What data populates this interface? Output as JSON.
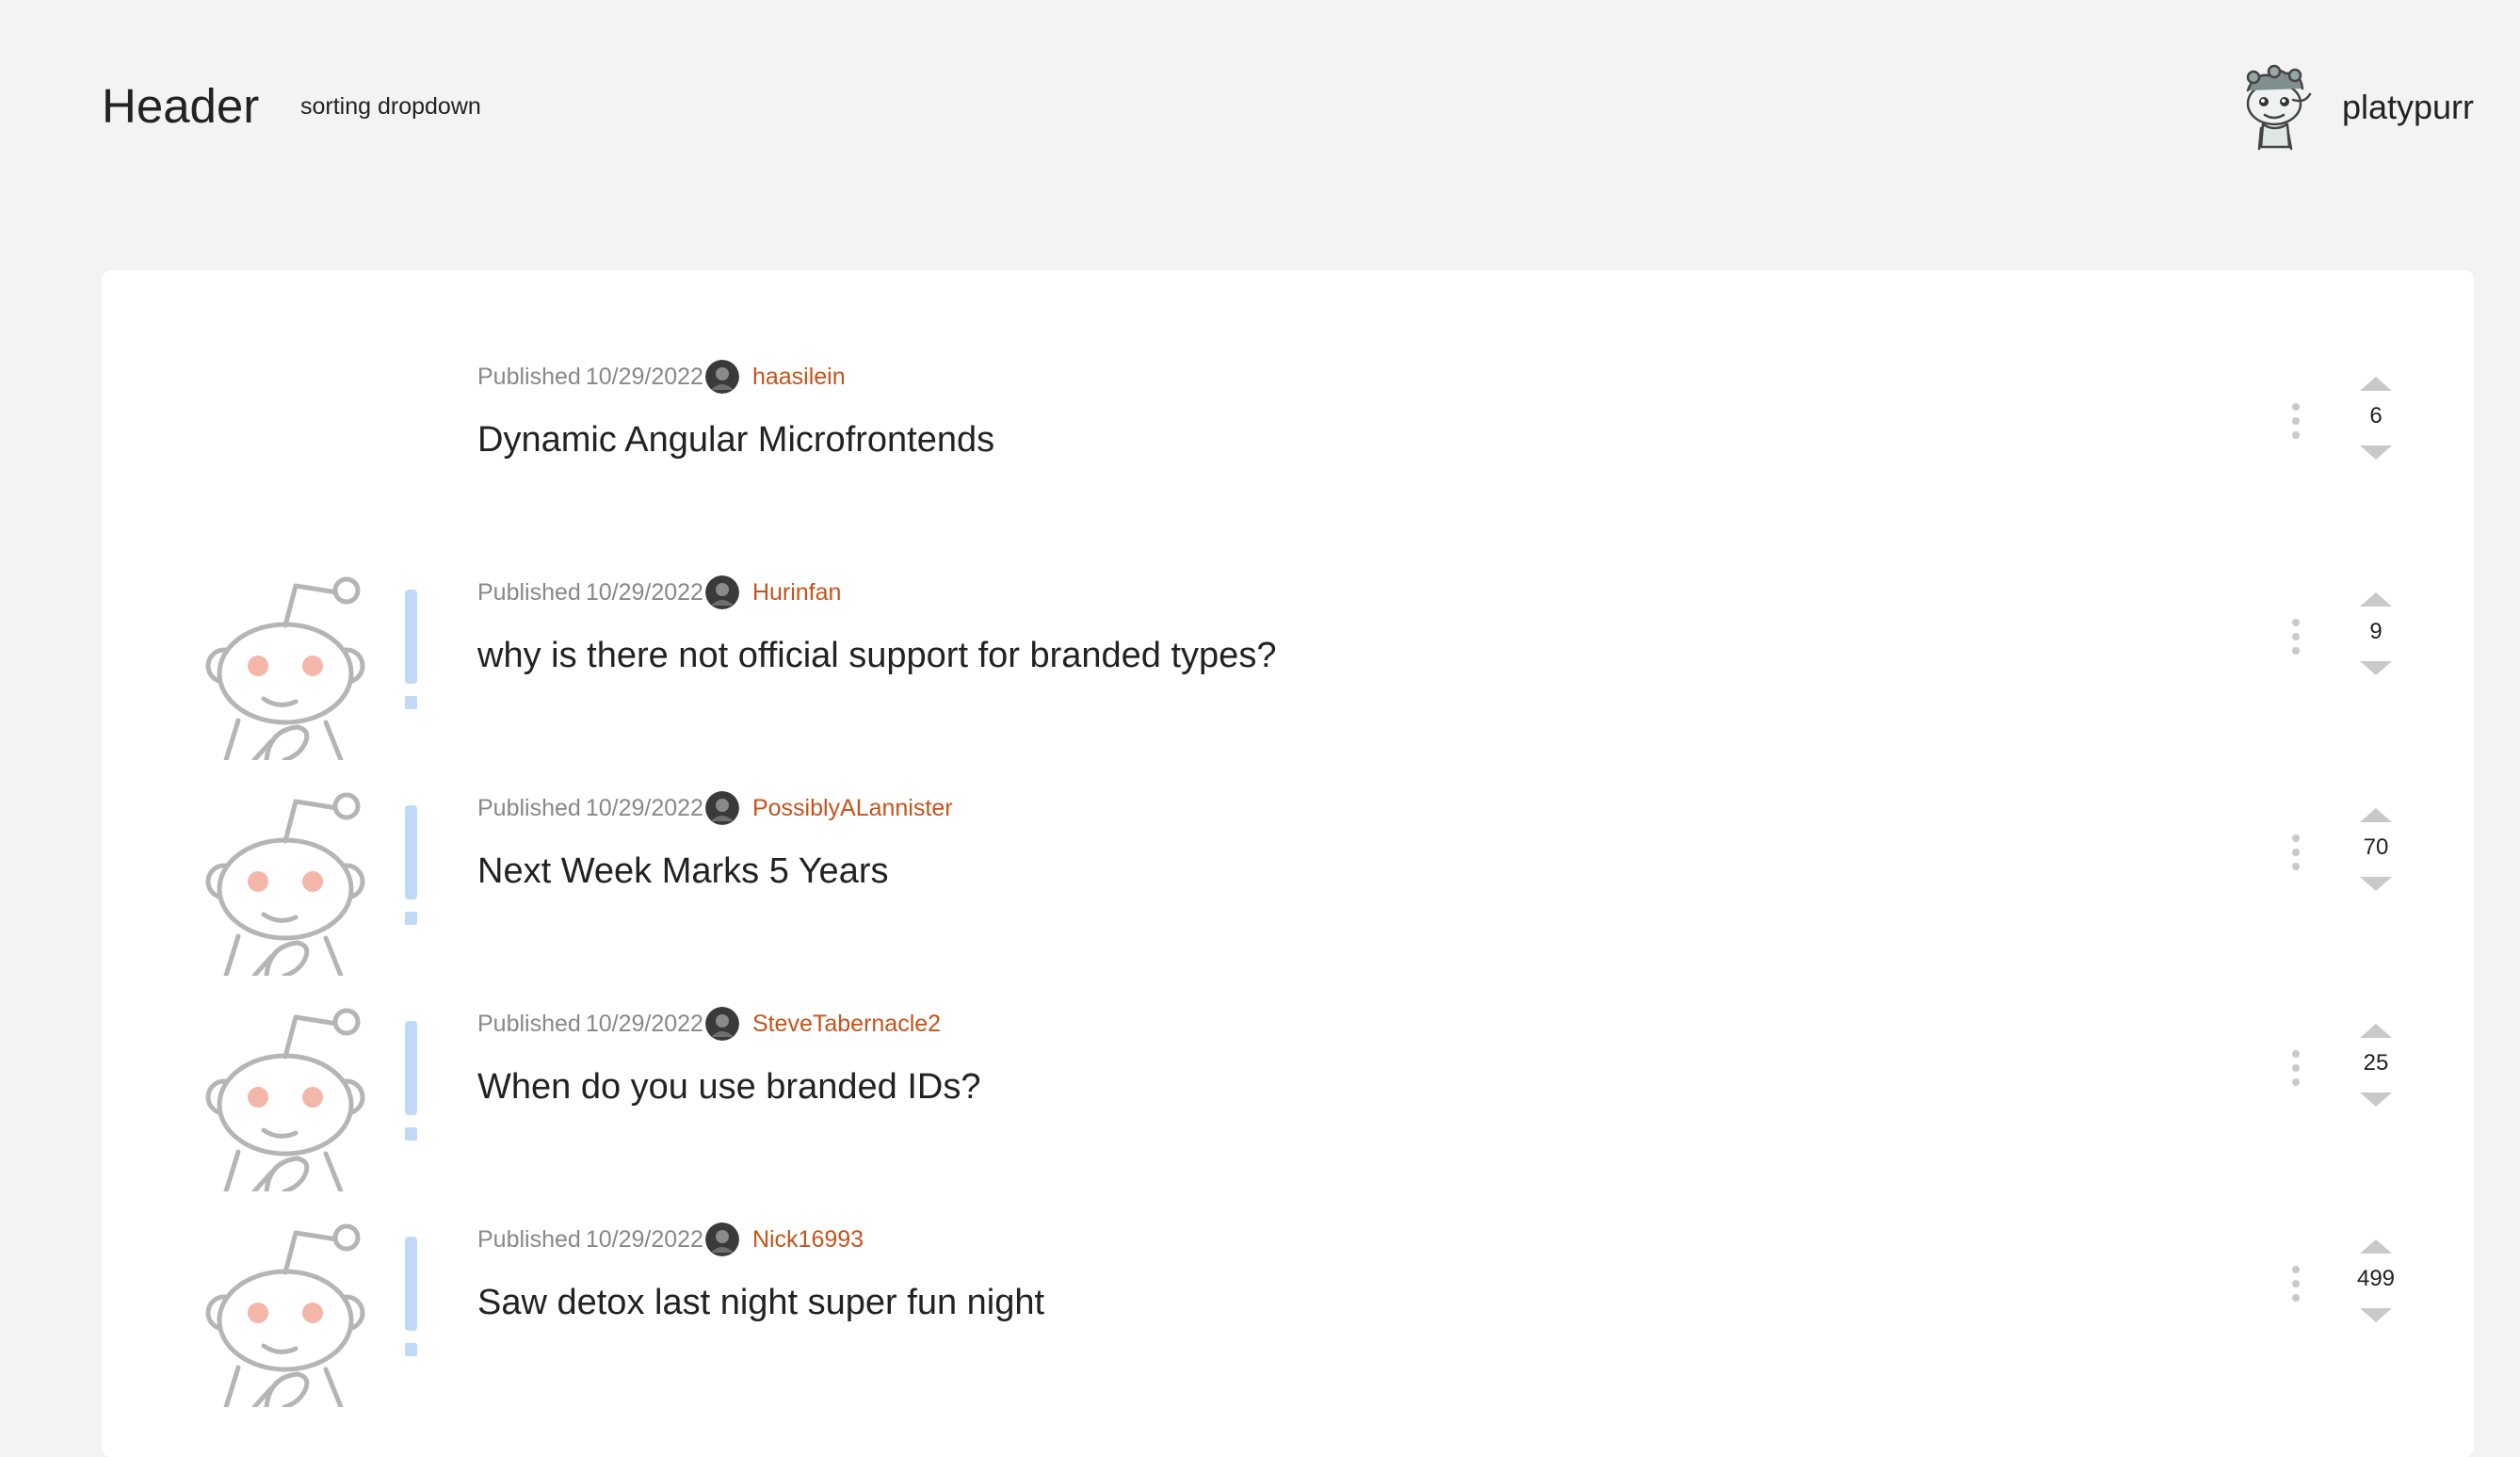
{
  "header": {
    "title": "Header",
    "sort_label": "sorting dropdown",
    "username": "platypurr"
  },
  "colors": {
    "author": "#c4541b",
    "background": "#f3f3f3",
    "panel": "#ffffff",
    "vote_arrow": "#c9c9c9"
  },
  "posts": [
    {
      "published_label": "Published",
      "date": "10/29/2022",
      "author": "haasilein",
      "title": "Dynamic Angular Microfrontends",
      "score": "6",
      "has_thumbnail": false
    },
    {
      "published_label": "Published",
      "date": "10/29/2022",
      "author": "Hurinfan",
      "title": "why is there not official support for branded types?",
      "score": "9",
      "has_thumbnail": true
    },
    {
      "published_label": "Published",
      "date": "10/29/2022",
      "author": "PossiblyALannister",
      "title": "Next Week Marks 5 Years",
      "score": "70",
      "has_thumbnail": true
    },
    {
      "published_label": "Published",
      "date": "10/29/2022",
      "author": "SteveTabernacle2",
      "title": "When do you use branded IDs?",
      "score": "25",
      "has_thumbnail": true
    },
    {
      "published_label": "Published",
      "date": "10/29/2022",
      "author": "Nick16993",
      "title": "Saw detox last night super fun night",
      "score": "499",
      "has_thumbnail": true
    }
  ]
}
